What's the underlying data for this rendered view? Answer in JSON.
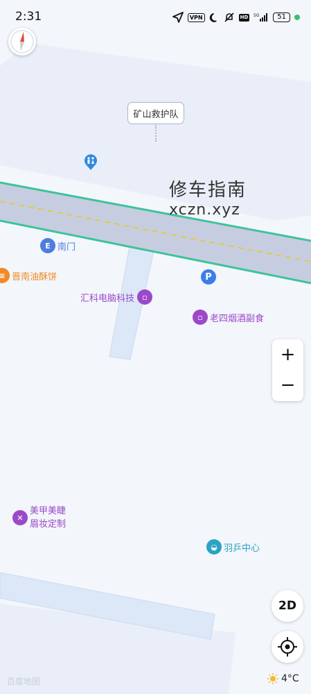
{
  "status_bar": {
    "time": "2:31",
    "vpn": "VPN",
    "hd": "HD",
    "network": "5G",
    "battery": "51"
  },
  "map": {
    "callout_label": "矿山救护队",
    "watermark": {
      "title": "修车指南",
      "url": "xczn.xyz"
    },
    "pois": [
      {
        "label": "南门",
        "color": "#4e7de0",
        "icon": "gate-icon"
      },
      {
        "label": "晋南油酥饼",
        "color": "#f08a24",
        "icon": "food-icon"
      },
      {
        "label": "汇科电脑科技",
        "color": "#9b49c9",
        "icon": "shopping-bag-icon"
      },
      {
        "label": "老四烟酒副食",
        "color": "#9b49c9",
        "icon": "shopping-bag-icon"
      },
      {
        "label_line1": "美甲美睫",
        "label_line2": "眉妆定制",
        "color": "#9b49c9",
        "icon": "beauty-icon"
      },
      {
        "label": "羽乒中心",
        "color": "#2aa3c4",
        "icon": "sports-icon"
      }
    ],
    "parking_symbol": "P",
    "toilet_icon": "toilet-icon"
  },
  "controls": {
    "zoom_in": "+",
    "zoom_out": "−",
    "mode_2d": "2D"
  },
  "footer": {
    "logo": "百度地图",
    "weather": "4°C",
    "weather_icon": "sun-icon"
  }
}
